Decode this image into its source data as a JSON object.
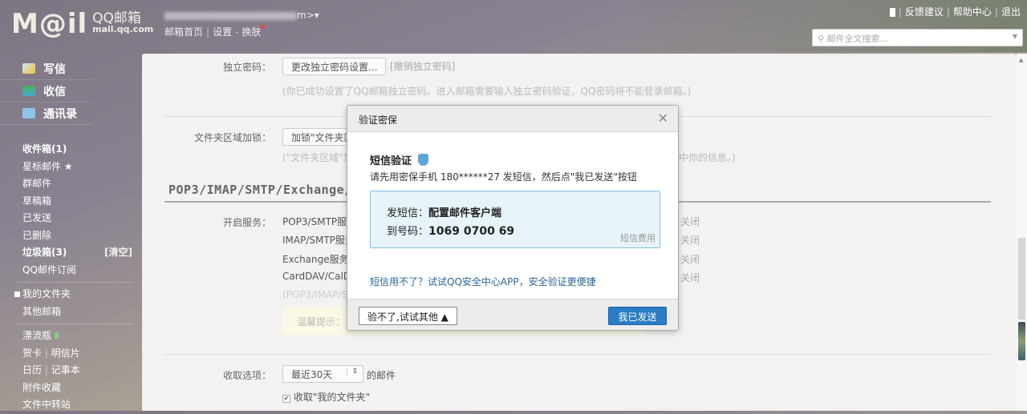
{
  "header": {
    "logo_text": "M@il",
    "brand": "QQ邮箱",
    "domain": "mail.qq.com",
    "account_suffix": "m>",
    "links": [
      "邮箱首页",
      "设置",
      "换肤"
    ],
    "right_links": [
      "反馈建议",
      "帮助中心",
      "退出"
    ],
    "search_placeholder": "邮件全文搜索..."
  },
  "sidebar": {
    "main": [
      "写信",
      "收信",
      "通讯录"
    ],
    "folders": [
      {
        "label": "收件箱(1)"
      },
      {
        "label": "星标邮件 ★"
      },
      {
        "label": "群邮件"
      },
      {
        "label": "草稿箱"
      },
      {
        "label": "已发送"
      },
      {
        "label": "已删除"
      },
      {
        "label": "垃圾箱(3)",
        "action": "[清空]"
      },
      {
        "label": "QQ邮件订阅"
      }
    ],
    "my_folders": "我的文件夹",
    "other_mail": "其他邮箱",
    "apps": [
      "漂流瓶",
      "贺卡",
      "明信片",
      "日历",
      "记事本",
      "附件收藏",
      "文件中转站"
    ]
  },
  "settings": {
    "pwd_label": "独立密码：",
    "pwd_button": "更改独立密码设置...",
    "pwd_cancel": "[撤销独立密码]",
    "pwd_note": "(你已成功设置了QQ邮箱独立密码。进入邮箱需要输入独立密码验证，QQ密码将不能登录邮箱。)",
    "lock_label": "文件夹区域加锁：",
    "lock_button": "加锁\"文件夹区",
    "lock_note_left": "(\"文件夹区域\"显",
    "lock_note_right": "中你的信息。)",
    "section_title": "POP3/IMAP/SMTP/Exchange/",
    "service_label": "开启服务：",
    "services": [
      "POP3/SMTP服",
      "IMAP/SMTP服务",
      "Exchange服务",
      "CardDAV/CalD"
    ],
    "service_status": [
      "关闭",
      "关闭",
      "关闭",
      "关闭"
    ],
    "service_note": "(POP3/IMAP/S",
    "tip": "温馨提示：",
    "fetch_label": "收取选项：",
    "fetch_select": "最近30天",
    "fetch_suffix": "的邮件",
    "fetch_check": "收取\"我的文件夹\""
  },
  "modal": {
    "title": "验证密保",
    "heading": "短信验证",
    "desc": "请先用密保手机 180******27 发短信，然后点\"我已发送\"按钮",
    "sms_label": "发短信：",
    "sms_content": "配置邮件客户端",
    "to_label": "到号码：",
    "to_number": "1069 0700 69",
    "fee": "短信费用",
    "alt_link": "短信用不了？试试QQ安全中心APP，安全验证更便捷",
    "other_button": "验不了,试试其他 ▲",
    "confirm_button": "我已发送"
  }
}
